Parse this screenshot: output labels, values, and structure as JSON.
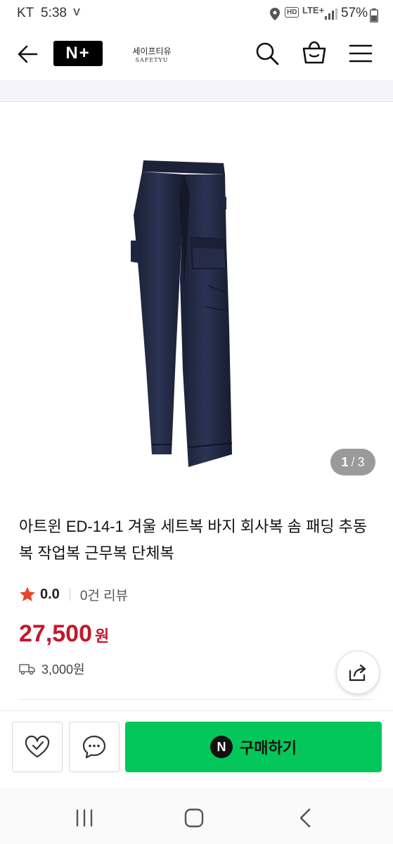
{
  "status_bar": {
    "carrier": "KT",
    "time": "5:38",
    "volte": "V",
    "hd": "HD",
    "network": "LTE+",
    "battery": "57%"
  },
  "header": {
    "logo_text": "N+",
    "brand_name_kr": "세이프티유",
    "brand_name_en": "SAFETYU"
  },
  "gallery": {
    "current": "1",
    "separator": "/",
    "total": "3"
  },
  "product": {
    "title": "아트윈 ED-14-1 겨울 세트복 바지 회사복 솜 패딩 추동복 작업복 근무복 단체복",
    "rating": "0.0",
    "reviews": "0건 리뷰",
    "price": "27,500",
    "currency": "원",
    "shipping": "3,000원"
  },
  "actions": {
    "buy_logo": "N",
    "buy_label": "구매하기"
  },
  "colors": {
    "price": "#c2182b",
    "buy_button": "#03c75a",
    "star": "#e8452f"
  }
}
